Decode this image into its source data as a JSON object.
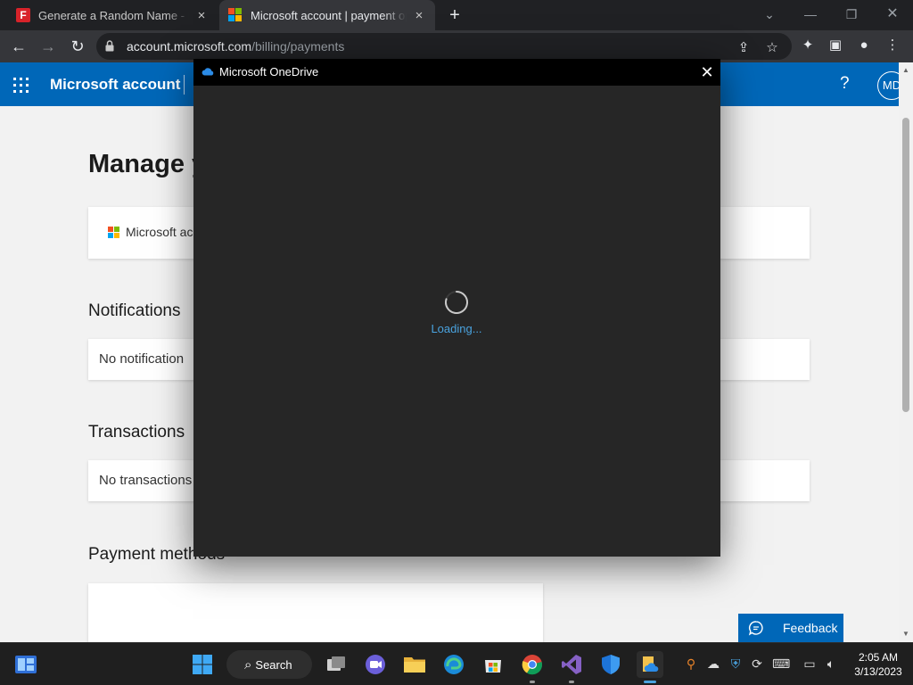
{
  "browser": {
    "tabs": [
      {
        "title": "Generate a Random Name - Fake",
        "close": "×",
        "favicon": "fakenamegenerator-f-icon"
      },
      {
        "title": "Microsoft account | payment opt",
        "close": "×",
        "favicon": "microsoft-logo-icon"
      }
    ],
    "new_tab": "+",
    "url_host": "account.microsoft.com",
    "url_path": "/billing/payments"
  },
  "page": {
    "brand": "Microsoft account",
    "help": "?",
    "avatar": "MD",
    "heading": "Manage y",
    "account_card": "Microsoft ac",
    "notifications_title": "Notifications",
    "notifications_empty": "No notification",
    "transactions_title": "Transactions",
    "transactions_empty": "No transactions",
    "payment_title": "Payment methods",
    "feedback": "Feedback"
  },
  "dialog": {
    "title": "Microsoft OneDrive",
    "close": "✕",
    "loading": "Loading..."
  },
  "taskbar": {
    "search": "Search",
    "time": "2:05 AM",
    "date": "3/13/2023"
  },
  "colors": {
    "brand_blue": "#0067b8",
    "dialog_bg": "#262626",
    "loading_blue": "#4aa3df"
  }
}
